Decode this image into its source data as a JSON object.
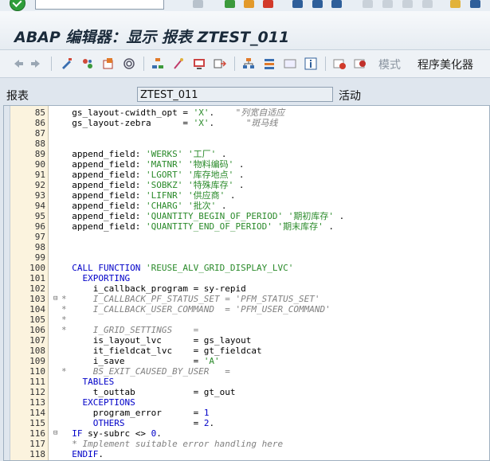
{
  "window": {
    "title": "ABAP 编辑器：显示 报表 ZTEST_011"
  },
  "toolbar": {
    "pretty_printer_label": "程序美化器",
    "pattern_label": "模式"
  },
  "fields": {
    "report_label": "报表",
    "report_value": "ZTEST_011",
    "status": "活动"
  },
  "code_lines": [
    {
      "n": "85",
      "t": [
        {
          "c": "id",
          "v": "  gs_layout-cwidth_opt = "
        },
        {
          "c": "str",
          "v": "'X'"
        },
        {
          "c": "id",
          "v": ".    "
        },
        {
          "c": "cmt",
          "v": "\"列宽自适应"
        }
      ]
    },
    {
      "n": "86",
      "t": [
        {
          "c": "id",
          "v": "  gs_layout-zebra      = "
        },
        {
          "c": "str",
          "v": "'X'"
        },
        {
          "c": "id",
          "v": ".      "
        },
        {
          "c": "cmt",
          "v": "\"斑马线"
        }
      ]
    },
    {
      "n": "87",
      "t": []
    },
    {
      "n": "88",
      "t": []
    },
    {
      "n": "89",
      "t": [
        {
          "c": "id",
          "v": "  append_field: "
        },
        {
          "c": "str",
          "v": "'WERKS' '工厂'"
        },
        {
          "c": "id",
          "v": " ."
        }
      ]
    },
    {
      "n": "90",
      "t": [
        {
          "c": "id",
          "v": "  append_field: "
        },
        {
          "c": "str",
          "v": "'MATNR' '物料编码'"
        },
        {
          "c": "id",
          "v": " ."
        }
      ]
    },
    {
      "n": "91",
      "t": [
        {
          "c": "id",
          "v": "  append_field: "
        },
        {
          "c": "str",
          "v": "'LGORT' '库存地点'"
        },
        {
          "c": "id",
          "v": " ."
        }
      ]
    },
    {
      "n": "92",
      "t": [
        {
          "c": "id",
          "v": "  append_field: "
        },
        {
          "c": "str",
          "v": "'SOBKZ' '特殊库存'"
        },
        {
          "c": "id",
          "v": " ."
        }
      ]
    },
    {
      "n": "93",
      "t": [
        {
          "c": "id",
          "v": "  append_field: "
        },
        {
          "c": "str",
          "v": "'LIFNR' '供应商'"
        },
        {
          "c": "id",
          "v": " ."
        }
      ]
    },
    {
      "n": "94",
      "t": [
        {
          "c": "id",
          "v": "  append_field: "
        },
        {
          "c": "str",
          "v": "'CHARG' '批次'"
        },
        {
          "c": "id",
          "v": " ."
        }
      ]
    },
    {
      "n": "95",
      "t": [
        {
          "c": "id",
          "v": "  append_field: "
        },
        {
          "c": "str",
          "v": "'QUANTITY_BEGIN_OF_PERIOD' '期初库存'"
        },
        {
          "c": "id",
          "v": " ."
        }
      ]
    },
    {
      "n": "96",
      "t": [
        {
          "c": "id",
          "v": "  append_field: "
        },
        {
          "c": "str",
          "v": "'QUANTITY_END_OF_PERIOD' '期末库存'"
        },
        {
          "c": "id",
          "v": " ."
        }
      ]
    },
    {
      "n": "97",
      "t": []
    },
    {
      "n": "98",
      "t": []
    },
    {
      "n": "99",
      "t": []
    },
    {
      "n": "100",
      "t": [
        {
          "c": "kw",
          "v": "  CALL FUNCTION "
        },
        {
          "c": "str",
          "v": "'REUSE_ALV_GRID_DISPLAY_LVC'"
        }
      ]
    },
    {
      "n": "101",
      "t": [
        {
          "c": "kw",
          "v": "    EXPORTING"
        }
      ]
    },
    {
      "n": "102",
      "t": [
        {
          "c": "id",
          "v": "      i_callback_program = sy-repid"
        }
      ]
    },
    {
      "n": "103",
      "f": "⊟",
      "t": [
        {
          "c": "cmt",
          "v": "*     I_CALLBACK_PF_STATUS_SET = 'PFM_STATUS_SET'"
        }
      ]
    },
    {
      "n": "104",
      "t": [
        {
          "c": "cmt",
          "v": "*     I_CALLBACK_USER_COMMAND  = 'PFM_USER_COMMAND'"
        }
      ]
    },
    {
      "n": "105",
      "t": [
        {
          "c": "cmt",
          "v": "*"
        }
      ]
    },
    {
      "n": "106",
      "t": [
        {
          "c": "cmt",
          "v": "*     I_GRID_SETTINGS    ="
        }
      ]
    },
    {
      "n": "107",
      "t": [
        {
          "c": "id",
          "v": "      is_layout_lvc      = gs_layout"
        }
      ]
    },
    {
      "n": "108",
      "t": [
        {
          "c": "id",
          "v": "      it_fieldcat_lvc    = gt_fieldcat"
        }
      ]
    },
    {
      "n": "109",
      "t": [
        {
          "c": "id",
          "v": "      i_save             = "
        },
        {
          "c": "str",
          "v": "'A'"
        }
      ]
    },
    {
      "n": "110",
      "t": [
        {
          "c": "cmt",
          "v": "*     BS_EXIT_CAUSED_BY_USER   ="
        }
      ]
    },
    {
      "n": "111",
      "t": [
        {
          "c": "kw",
          "v": "    TABLES"
        }
      ]
    },
    {
      "n": "112",
      "t": [
        {
          "c": "id",
          "v": "      t_outtab           = gt_out"
        }
      ]
    },
    {
      "n": "113",
      "t": [
        {
          "c": "kw",
          "v": "    EXCEPTIONS"
        }
      ]
    },
    {
      "n": "114",
      "t": [
        {
          "c": "id",
          "v": "      program_error      = "
        },
        {
          "c": "num",
          "v": "1"
        }
      ]
    },
    {
      "n": "115",
      "t": [
        {
          "c": "kw",
          "v": "      OTHERS             "
        },
        {
          "c": "id",
          "v": "= "
        },
        {
          "c": "num",
          "v": "2"
        },
        {
          "c": "id",
          "v": "."
        }
      ]
    },
    {
      "n": "116",
      "f": "⊟",
      "t": [
        {
          "c": "kw",
          "v": "  IF "
        },
        {
          "c": "id",
          "v": "sy-subrc <> "
        },
        {
          "c": "num",
          "v": "0"
        },
        {
          "c": "id",
          "v": "."
        }
      ]
    },
    {
      "n": "117",
      "t": [
        {
          "c": "cmt",
          "v": "  * Implement suitable error handling here"
        }
      ]
    },
    {
      "n": "118",
      "t": [
        {
          "c": "kw",
          "v": "  ENDIF"
        },
        {
          "c": "id",
          "v": "."
        }
      ]
    }
  ],
  "icons": [
    "back-icon",
    "forward-icon",
    "toggle-icon",
    "other-object-icon",
    "activate-icon",
    "where-used-icon",
    "hierarchy-icon",
    "debugger-icon",
    "display-icon",
    "insert-icon",
    "info-icon"
  ]
}
